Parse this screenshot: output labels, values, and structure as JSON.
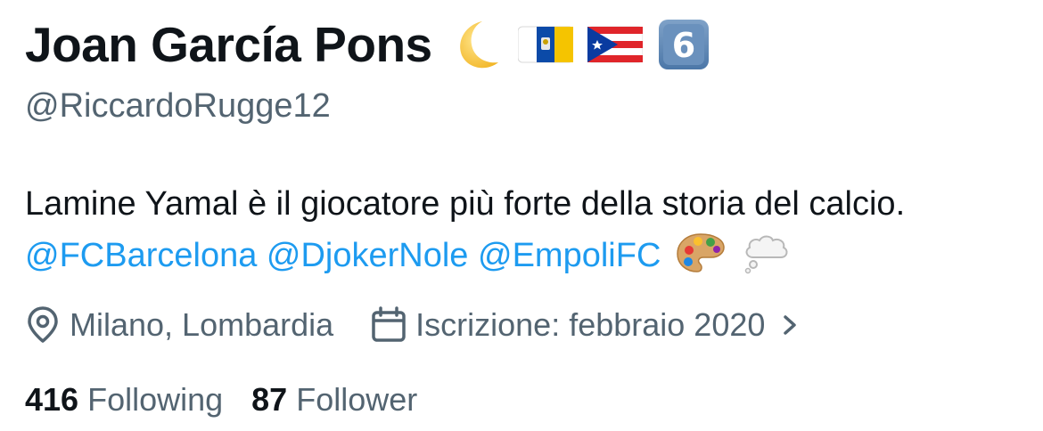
{
  "profile": {
    "display_name": "Joan García Pons",
    "name_emojis": [
      "crescent-moon-emoji",
      "canary-islands-flag-emoji",
      "puerto-rico-flag-emoji",
      "keycap-six-emoji"
    ],
    "keycap_text": "6",
    "handle": "@RiccardoRugge12",
    "bio": {
      "text": "Lamine Yamal è il giocatore più forte della storia del calcio.",
      "mentions": [
        "@FCBarcelona",
        "@DjokerNole",
        "@EmpoliFC"
      ],
      "trailing_emojis": [
        "artist-palette-emoji",
        "thought-balloon-emoji"
      ]
    },
    "location": "Milano, Lombardia",
    "joined": "Iscrizione: febbraio 2020",
    "following_count": "416",
    "following_label": "Following",
    "follower_count": "87",
    "follower_label": "Follower"
  },
  "colors": {
    "text_primary": "#0f1419",
    "text_secondary": "#536471",
    "link": "#1d9bf0"
  },
  "icons": {
    "location": "map-pin-icon",
    "joined": "calendar-icon",
    "joined_more": "chevron-right-icon"
  }
}
